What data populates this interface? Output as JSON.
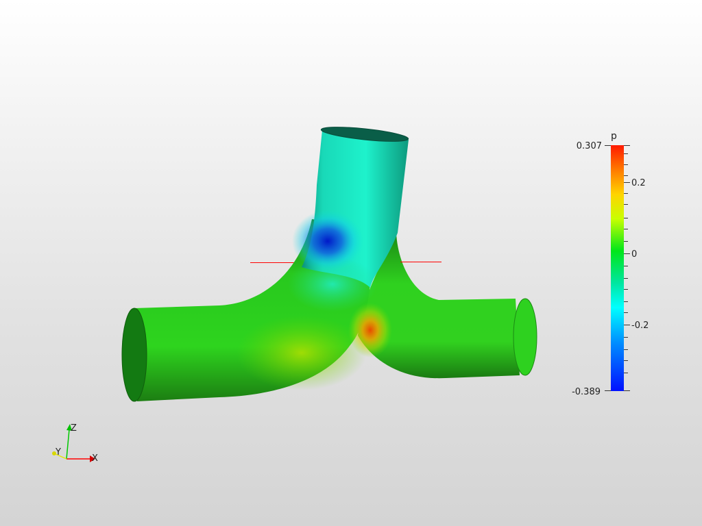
{
  "scalar_bar": {
    "title": "p",
    "labels": {
      "max": "0.307",
      "upper": "0.2",
      "zero": "0",
      "lower": "-0.2",
      "min": "-0.389"
    },
    "colormap": [
      "#ff0000",
      "#ff8c00",
      "#ffff00",
      "#00e000",
      "#00ffff",
      "#0080ff",
      "#0000ff"
    ]
  },
  "axes": {
    "x": "X",
    "y": "Y",
    "z": "Z"
  },
  "colors": {
    "x_axis": "#ff0000",
    "y_axis": "#e6e600",
    "z_axis": "#00c800",
    "section_line": "#ff0000",
    "surface_green": "#1ec51e",
    "low_pressure": "#0022cc",
    "high_pressure": "#ff5500"
  }
}
